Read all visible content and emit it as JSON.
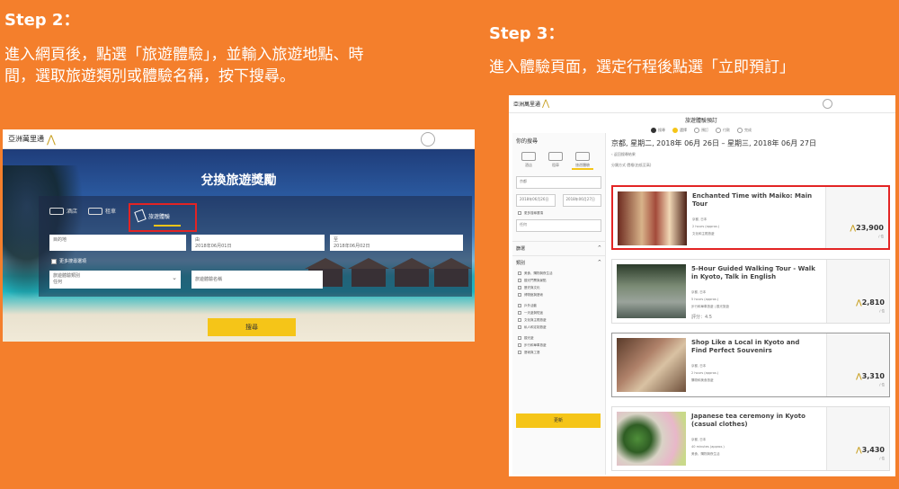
{
  "step2": {
    "title": "Step 2：",
    "line1": "進入網頁後，點選「旅遊體驗」，並輸入旅遊地點、時",
    "line2": "間，選取旅遊類別或體驗名稱，按下搜尋。"
  },
  "step3": {
    "title": "Step 3：",
    "line1": "進入體驗頁面，選定行程後點選「立即預訂」"
  },
  "left_shot": {
    "logo": "亞洲萬里通",
    "hero_title": "兌換旅遊獎勵",
    "tabs": [
      "酒店",
      "租車"
    ],
    "active_tab": "旅遊體驗",
    "destination_placeholder": "目的地",
    "date_from_label": "由",
    "date_from": "2018年06月01日",
    "date_to_label": "至",
    "date_to": "2018年06月02日",
    "more_options": "更多搜尋選項",
    "category_label": "旅遊體驗類別",
    "category_value": "任何",
    "experience_name_placeholder": "旅遊體驗名稱",
    "search_button": "搜尋"
  },
  "right_shot": {
    "logo": "亞洲萬里通",
    "progress_title": "旅遊體驗預訂",
    "steps": [
      "搜尋",
      "選擇",
      "預訂",
      "付款",
      "完成"
    ],
    "sidebar": {
      "heading": "你的搜尋",
      "icons": [
        "酒店",
        "租車",
        "旅遊體驗"
      ],
      "destination": "京都",
      "date_from": "2018年06月26日",
      "date_to": "2018年06月27日",
      "more_options": "更多搜尋選項",
      "category": "任何",
      "search_button": "更新",
      "filter_heading": "篩選",
      "category_heading": "類別",
      "checks": [
        "美食、購物與夜生活",
        "觀光門票與景點",
        "歷史與文化",
        "博物館與藝術",
        "戶外活動",
        "一天遊與短途",
        "文化與主題旅遊",
        "私人和定制旅遊",
        "觀光遊",
        "步行和單車旅遊",
        "藝術與工藝"
      ]
    },
    "date_heading": "京都, 星期二, 2018年 06月 26日 – 星期三, 2018年 06月 27日",
    "back_link": "‹ 返回搜尋結果",
    "sort": "分類方式  價格(由低至高)",
    "cards": [
      {
        "title": "Enchanted Time with Maiko: Main Tour",
        "loc": "京都, 日本",
        "duration": "2 hours (approx.)",
        "tag": "文化和主題旅遊",
        "price": "23,900",
        "unit": "/ 位",
        "highlight": true
      },
      {
        "title": "5-Hour Guided Walking Tour - Walk in Kyoto, Talk in English",
        "loc": "京都, 日本",
        "duration": "5 hours (approx.)",
        "tag": "步行和單車旅遊 | 觀光旅遊",
        "rating": "評分：4.5",
        "price": "2,810",
        "unit": "/ 位",
        "highlight": false
      },
      {
        "title": "Shop Like a Local in Kyoto and Find Perfect Souvenirs",
        "loc": "京都, 日本",
        "duration": "2 hours (approx.)",
        "tag": "購物和美食旅遊",
        "price": "3,310",
        "unit": "/ 位",
        "highlight": false
      },
      {
        "title": "Japanese tea ceremony in Kyoto (casual clothes)",
        "loc": "京都, 日本",
        "duration": "40 minutes (approx.)",
        "tag": "美食、購物與夜生活",
        "price": "3,430",
        "unit": "/ 位",
        "highlight": false
      }
    ]
  },
  "colors": {
    "background": "#f47f2c",
    "accent_yellow": "#f5c518",
    "highlight_red": "#e32424"
  }
}
